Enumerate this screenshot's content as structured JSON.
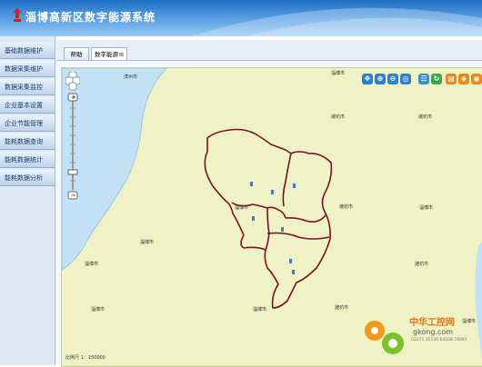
{
  "app": {
    "title": "淄博高新区数字能源系统"
  },
  "sidebar": {
    "items": [
      {
        "label": "基础数据维护"
      },
      {
        "label": "数据采集维护"
      },
      {
        "label": "数据采集监控"
      },
      {
        "label": "企业基本设置"
      },
      {
        "label": "企业节能管理"
      },
      {
        "label": "能耗数据查询"
      },
      {
        "label": "能耗数据统计"
      },
      {
        "label": "能耗数据分析"
      }
    ]
  },
  "tabs": [
    {
      "label": "帮助",
      "close": ""
    },
    {
      "label": "数字能源",
      "close": "⊠"
    }
  ],
  "map": {
    "places": [
      {
        "label": "滨州市"
      },
      {
        "label": "淄博市"
      },
      {
        "label": "潍坊市"
      },
      {
        "label": "潍坊市"
      },
      {
        "label": "淄博市"
      },
      {
        "label": "潍坊市"
      },
      {
        "label": "淄博市"
      },
      {
        "label": "淄博市"
      },
      {
        "label": "淄博市"
      },
      {
        "label": "潍坊市"
      },
      {
        "label": "淄博市"
      },
      {
        "label": "潍坊市"
      },
      {
        "label": "淄博市"
      },
      {
        "label": "淄博市"
      }
    ],
    "scale": "比例尺 1：150000",
    "zoom_plus": "+",
    "zoom_minus": "−"
  },
  "toolbar": {
    "icons": [
      "pan-icon",
      "zoom-in-icon",
      "zoom-out-icon",
      "full-extent-icon",
      "layers-icon",
      "refresh-icon",
      "measure-icon",
      "identify-icon",
      "clear-icon"
    ]
  },
  "watermark": {
    "text_cn": "中华工控网",
    "domain": "gkong.com",
    "small": "02271 35130 64508 78891"
  },
  "colors": {
    "header": "#3d88d6",
    "water": "#c3e1f5",
    "land": "#eef2c4",
    "boundary": "#7a1020"
  }
}
